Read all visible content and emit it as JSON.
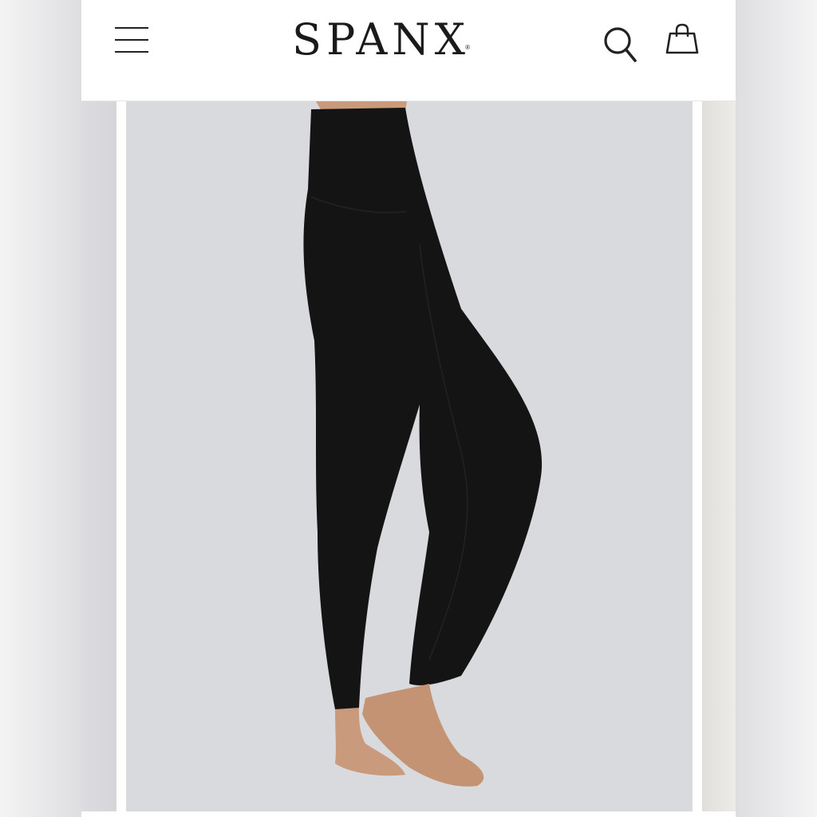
{
  "header": {
    "brand": "SPANX",
    "trademark": "®",
    "menu_icon": "hamburger-menu-icon",
    "search_icon": "search-icon",
    "bag_icon": "shopping-bag-icon"
  },
  "colors": {
    "background": "#ffffff",
    "text": "#1a1a1a",
    "slide_background": "#d9dade",
    "product": "#141414",
    "skin": "#c99a7c"
  },
  "carousel": {
    "main_image": "black-high-waist-leggings-product-image",
    "prev_image": "previous-slide-image",
    "next_image": "next-slide-image"
  }
}
